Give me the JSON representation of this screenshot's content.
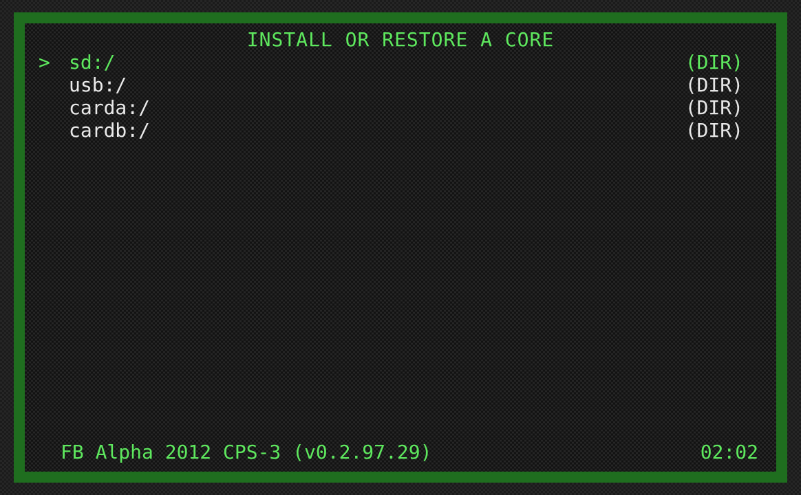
{
  "screen": {
    "title": "INSTALL OR RESTORE A CORE",
    "cursor_glyph": ">",
    "items": [
      {
        "path": "sd:/",
        "kind": "(DIR)",
        "selected": true
      },
      {
        "path": "usb:/",
        "kind": "(DIR)",
        "selected": false
      },
      {
        "path": "carda:/",
        "kind": "(DIR)",
        "selected": false
      },
      {
        "path": "cardb:/",
        "kind": "(DIR)",
        "selected": false
      }
    ]
  },
  "footer": {
    "core_name": "FB Alpha 2012 CPS-3 (v0.2.97.29)",
    "clock": "02:02"
  },
  "colors": {
    "accent_green": "#5ee85e",
    "frame_green": "#1f6e1f",
    "text_white": "#eaeaea",
    "background": "#1b1b1b"
  }
}
